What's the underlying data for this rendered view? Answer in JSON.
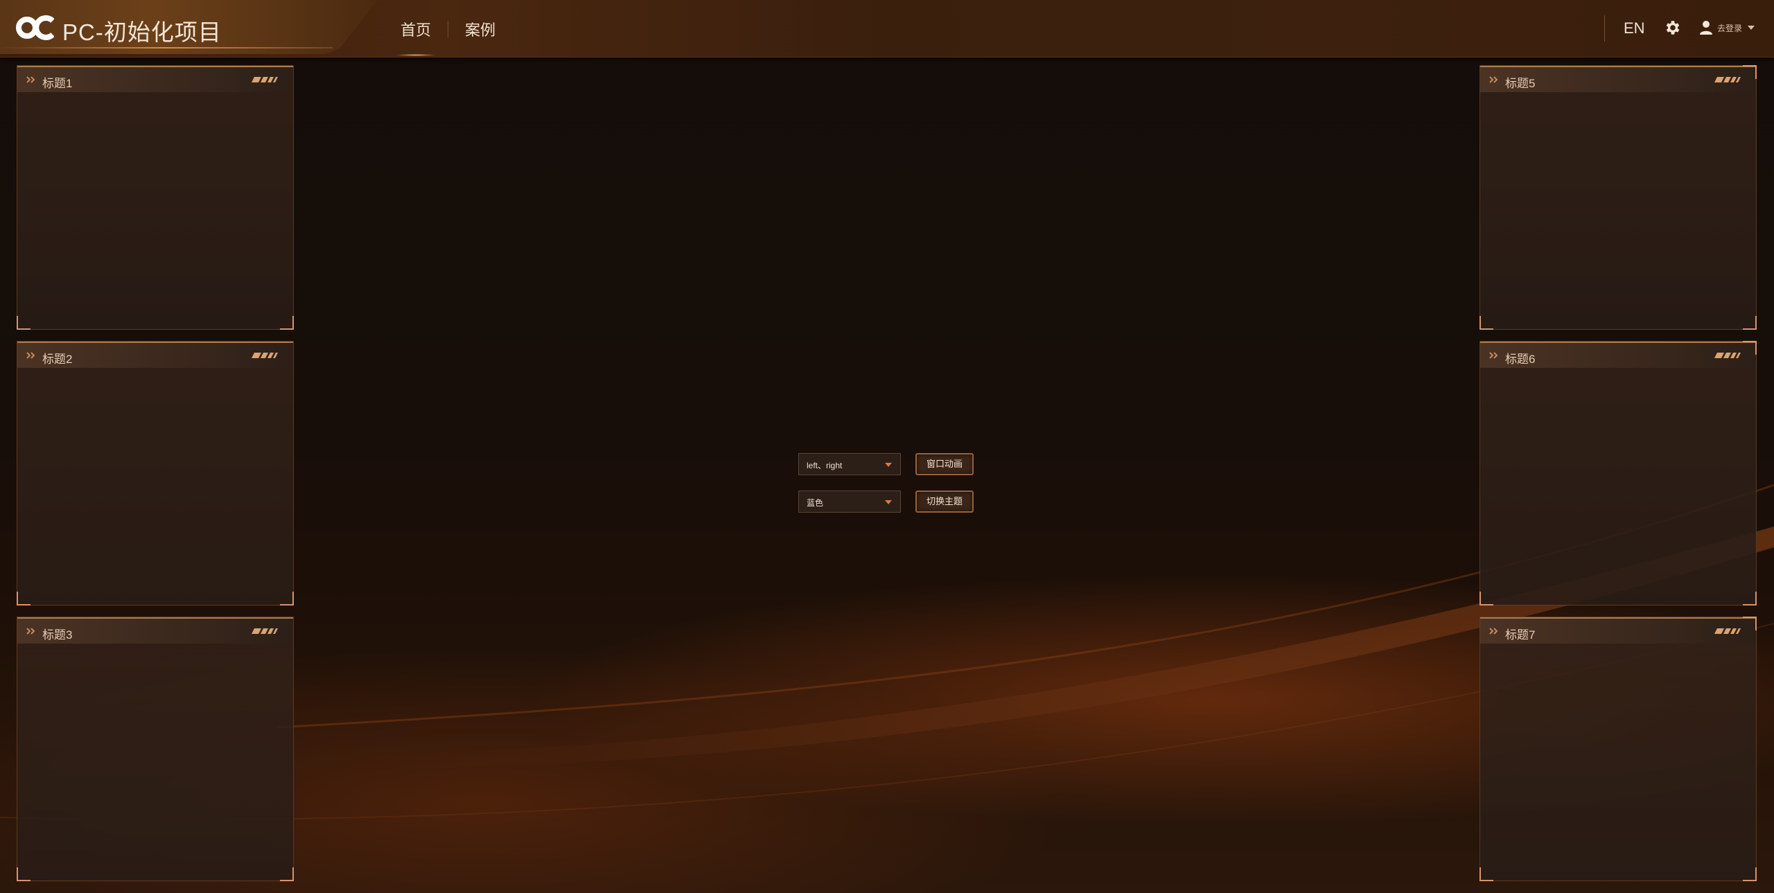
{
  "header": {
    "app_title": "PC-初始化项目",
    "nav": [
      {
        "label": "首页",
        "active": true
      },
      {
        "label": "案例",
        "active": false
      }
    ],
    "language": "EN",
    "settings_icon": "gear-icon",
    "user": {
      "icon": "user-icon",
      "label": "去登录"
    }
  },
  "panels_left": [
    {
      "title": "标题1"
    },
    {
      "title": "标题2"
    },
    {
      "title": "标题3"
    }
  ],
  "panels_right": [
    {
      "title": "标题5"
    },
    {
      "title": "标题6"
    },
    {
      "title": "标题7"
    }
  ],
  "controls": {
    "animation_select": {
      "value": "left、right"
    },
    "animation_button": "窗口动画",
    "theme_select": {
      "value": "蓝色"
    },
    "theme_button": "切换主题"
  },
  "colors": {
    "accent": "#d9946a",
    "caret": "#e0764a",
    "background": "#170e09"
  }
}
